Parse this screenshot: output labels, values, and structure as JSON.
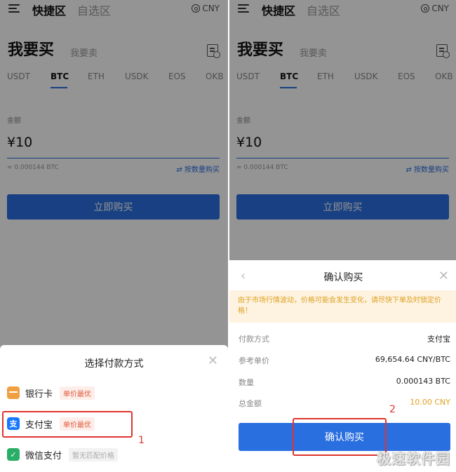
{
  "header": {
    "tab_fast": "快捷区",
    "tab_fav": "自选区",
    "currency": "CNY"
  },
  "page": {
    "buy_title": "我要买",
    "sell_title": "我要卖"
  },
  "coin_tabs": [
    "USDT",
    "BTC",
    "ETH",
    "USDK",
    "EOS",
    "OKB"
  ],
  "left": {
    "amount_label": "金额",
    "amount_value": "¥10",
    "btc_approx": "≈ 0.000144 BTC",
    "by_quantity": "⇄ 按数量购买",
    "buy_button": "立即购买"
  },
  "right": {
    "amount_label": "金额",
    "amount_value": "¥10",
    "btc_approx": "≈ 0.000144 BTC",
    "by_quantity": "⇄ 按数量购买",
    "buy_button": "立即购买"
  },
  "payment_sheet": {
    "title": "选择付款方式",
    "methods": [
      {
        "name": "银行卡",
        "badge": "单价最优"
      },
      {
        "name": "支付宝",
        "badge": "单价最优"
      },
      {
        "name": "微信支付",
        "badge": "暂无匹配价格"
      }
    ],
    "step_label": "1"
  },
  "confirm_modal": {
    "title": "确认购买",
    "warning": "由于市场行情波动，价格可能会发生变化，请尽快下单及时锁定价格！",
    "rows": [
      {
        "label": "付款方式",
        "value": "支付宝"
      },
      {
        "label": "参考单价",
        "value": "69,654.64 CNY/BTC"
      },
      {
        "label": "数量",
        "value": "0.000143 BTC"
      },
      {
        "label": "总金额",
        "value": "10.00 CNY"
      }
    ],
    "confirm_button": "确认购买",
    "step_label": "2"
  },
  "watermark": "极速软件园",
  "colors": {
    "accent": "#2a6fe0",
    "highlight": "#e0332e",
    "warning": "#e0a020"
  }
}
